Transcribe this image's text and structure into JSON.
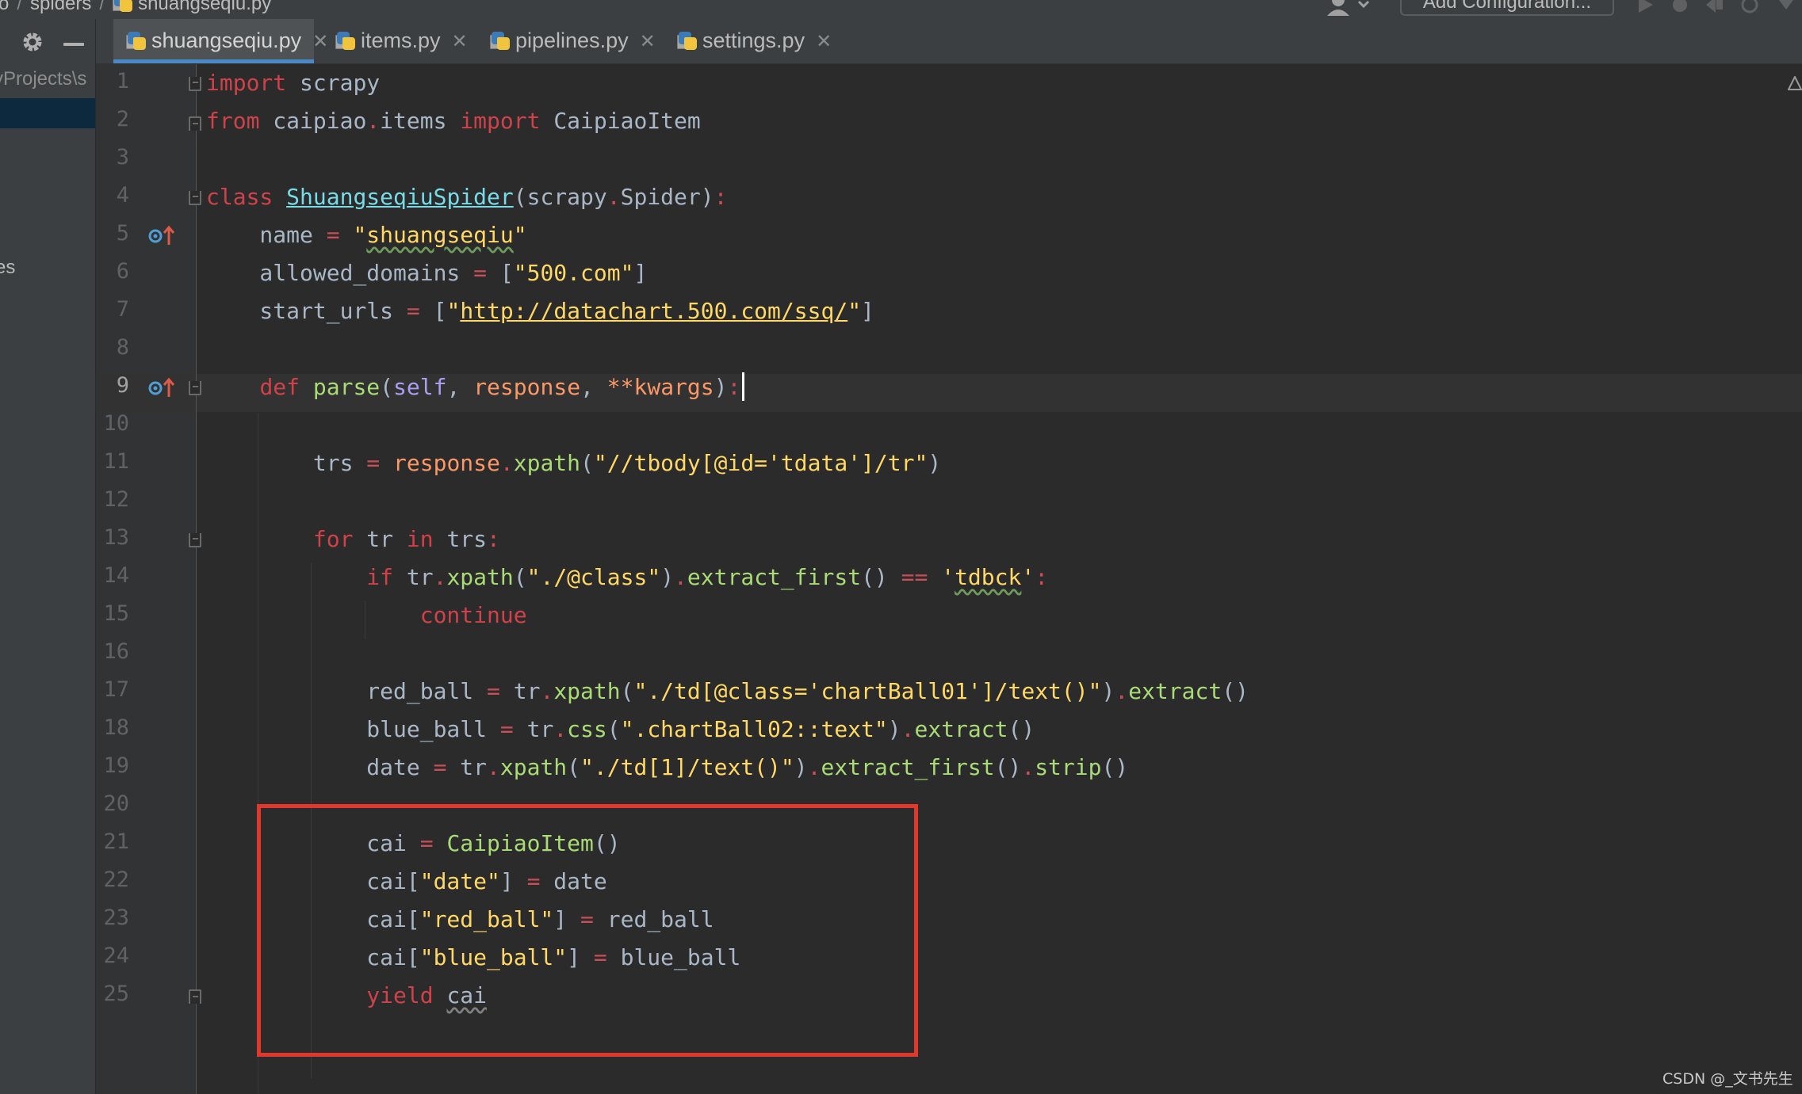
{
  "breadcrumb": {
    "items": [
      "o",
      "spiders",
      "shuangseqiu.py"
    ]
  },
  "toolbar": {
    "add_configuration_label": "Add Configuration..."
  },
  "project_panel": {
    "path_text": "yProjects\\s",
    "tree_fragment": "es"
  },
  "tabs": [
    {
      "label": "shuangseqiu.py",
      "active": true
    },
    {
      "label": "items.py",
      "active": false
    },
    {
      "label": "pipelines.py",
      "active": false
    },
    {
      "label": "settings.py",
      "active": false
    }
  ],
  "editor": {
    "line_numbers": [
      "1",
      "2",
      "3",
      "4",
      "5",
      "6",
      "7",
      "8",
      "9",
      "10",
      "11",
      "12",
      "13",
      "14",
      "15",
      "16",
      "17",
      "18",
      "19",
      "20",
      "21",
      "22",
      "23",
      "24",
      "25"
    ],
    "current_line": 9,
    "lines": [
      "import scrapy",
      "from caipiao.items import CaipiaoItem",
      "",
      "class ShuangseqiuSpider(scrapy.Spider):",
      "    name = \"shuangseqiu\"",
      "    allowed_domains = [\"500.com\"]",
      "    start_urls = [\"http://datachart.500.com/ssq/\"]",
      "",
      "    def parse(self, response, **kwargs):",
      "",
      "        trs = response.xpath(\"//tbody[@id='tdata']/tr\")",
      "",
      "        for tr in trs:",
      "            if tr.xpath(\"./@class\").extract_first() == 'tdbck':",
      "                continue",
      "",
      "            red_ball = tr.xpath(\"./td[@class='chartBall01']/text()\").extract()",
      "            blue_ball = tr.css(\".chartBall02::text\").extract()",
      "            date = tr.xpath(\"./td[1]/text()\").extract_first().strip()",
      "",
      "            cai = CaipiaoItem()",
      "            cai[\"date\"] = date",
      "            cai[\"red_ball\"] = red_ball",
      "            cai[\"blue_ball\"] = blue_ball",
      "            yield cai"
    ]
  },
  "watermark": "CSDN @_文书先生",
  "colors": {
    "keyword": "#d0424a",
    "string": "#ffd866",
    "function": "#a9dc76",
    "class_name": "#78dce8",
    "highlight_box": "#e0382c",
    "active_tab_underline": "#4a88c7"
  }
}
